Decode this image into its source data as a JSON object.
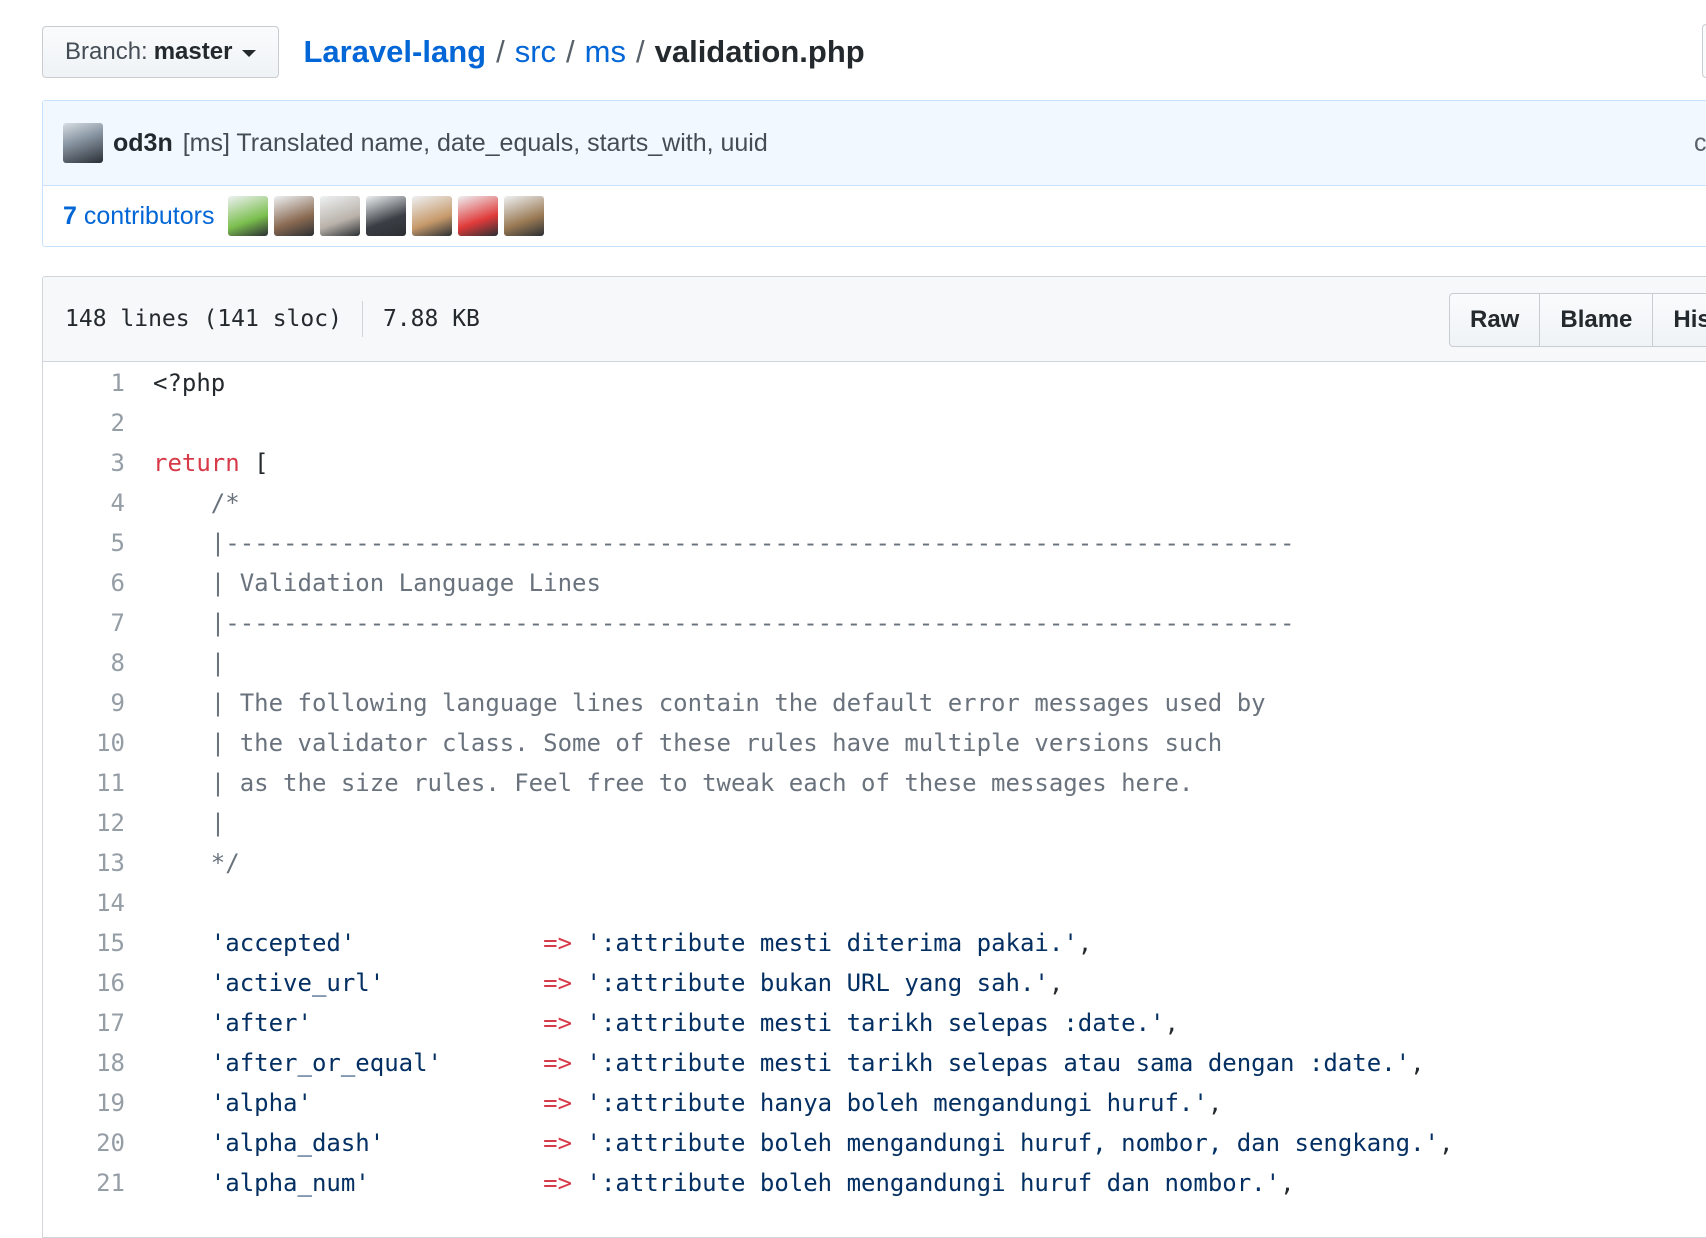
{
  "branch": {
    "label": "Branch:",
    "value": "master"
  },
  "breadcrumb": {
    "repo": "Laravel-lang",
    "path1": "src",
    "path2": "ms",
    "file": "validation.php",
    "sep": "/"
  },
  "commit": {
    "author": "od3n",
    "message": "[ms] Translated name, date_equals, starts_with, uuid",
    "trailing_char": "c"
  },
  "contributors": {
    "count": "7",
    "label": "contributors",
    "avatar_colors": [
      "#7bbf4e",
      "#8a6a52",
      "#b9b2aa",
      "#3b3f45",
      "#c79a6b",
      "#e03a3a",
      "#9b7b55"
    ]
  },
  "file": {
    "lines": "148 lines (141 sloc)",
    "size": "7.88 KB"
  },
  "buttons": {
    "raw": "Raw",
    "blame": "Blame",
    "history": "His"
  },
  "colors": {
    "link": "#0366d6",
    "keyword": "#d73a49",
    "comment": "#6a737d",
    "string": "#032f62"
  },
  "code": {
    "l1": "<?php",
    "l3_kw": "return",
    "l3_rest": " [",
    "l4": "    /*",
    "l5": "    |--------------------------------------------------------------------------",
    "l6": "    | Validation Language Lines",
    "l7": "    |--------------------------------------------------------------------------",
    "l8": "    |",
    "l9": "    | The following language lines contain the default error messages used by",
    "l10": "    | the validator class. Some of these rules have multiple versions such",
    "l11": "    | as the size rules. Feel free to tweak each of these messages here.",
    "l12": "    |",
    "l13": "    */",
    "arrow": "=>",
    "entries": [
      {
        "key": "    'accepted'             ",
        "val": " ':attribute mesti diterima pakai.'",
        "end": ","
      },
      {
        "key": "    'active_url'           ",
        "val": " ':attribute bukan URL yang sah.'",
        "end": ","
      },
      {
        "key": "    'after'                ",
        "val": " ':attribute mesti tarikh selepas :date.'",
        "end": ","
      },
      {
        "key": "    'after_or_equal'       ",
        "val": " ':attribute mesti tarikh selepas atau sama dengan :date.'",
        "end": ","
      },
      {
        "key": "    'alpha'                ",
        "val": " ':attribute hanya boleh mengandungi huruf.'",
        "end": ","
      },
      {
        "key": "    'alpha_dash'           ",
        "val": " ':attribute boleh mengandungi huruf, nombor, dan sengkang.'",
        "end": ","
      },
      {
        "key": "    'alpha_num'            ",
        "val": " ':attribute boleh mengandungi huruf dan nombor.'",
        "end": ","
      }
    ]
  }
}
